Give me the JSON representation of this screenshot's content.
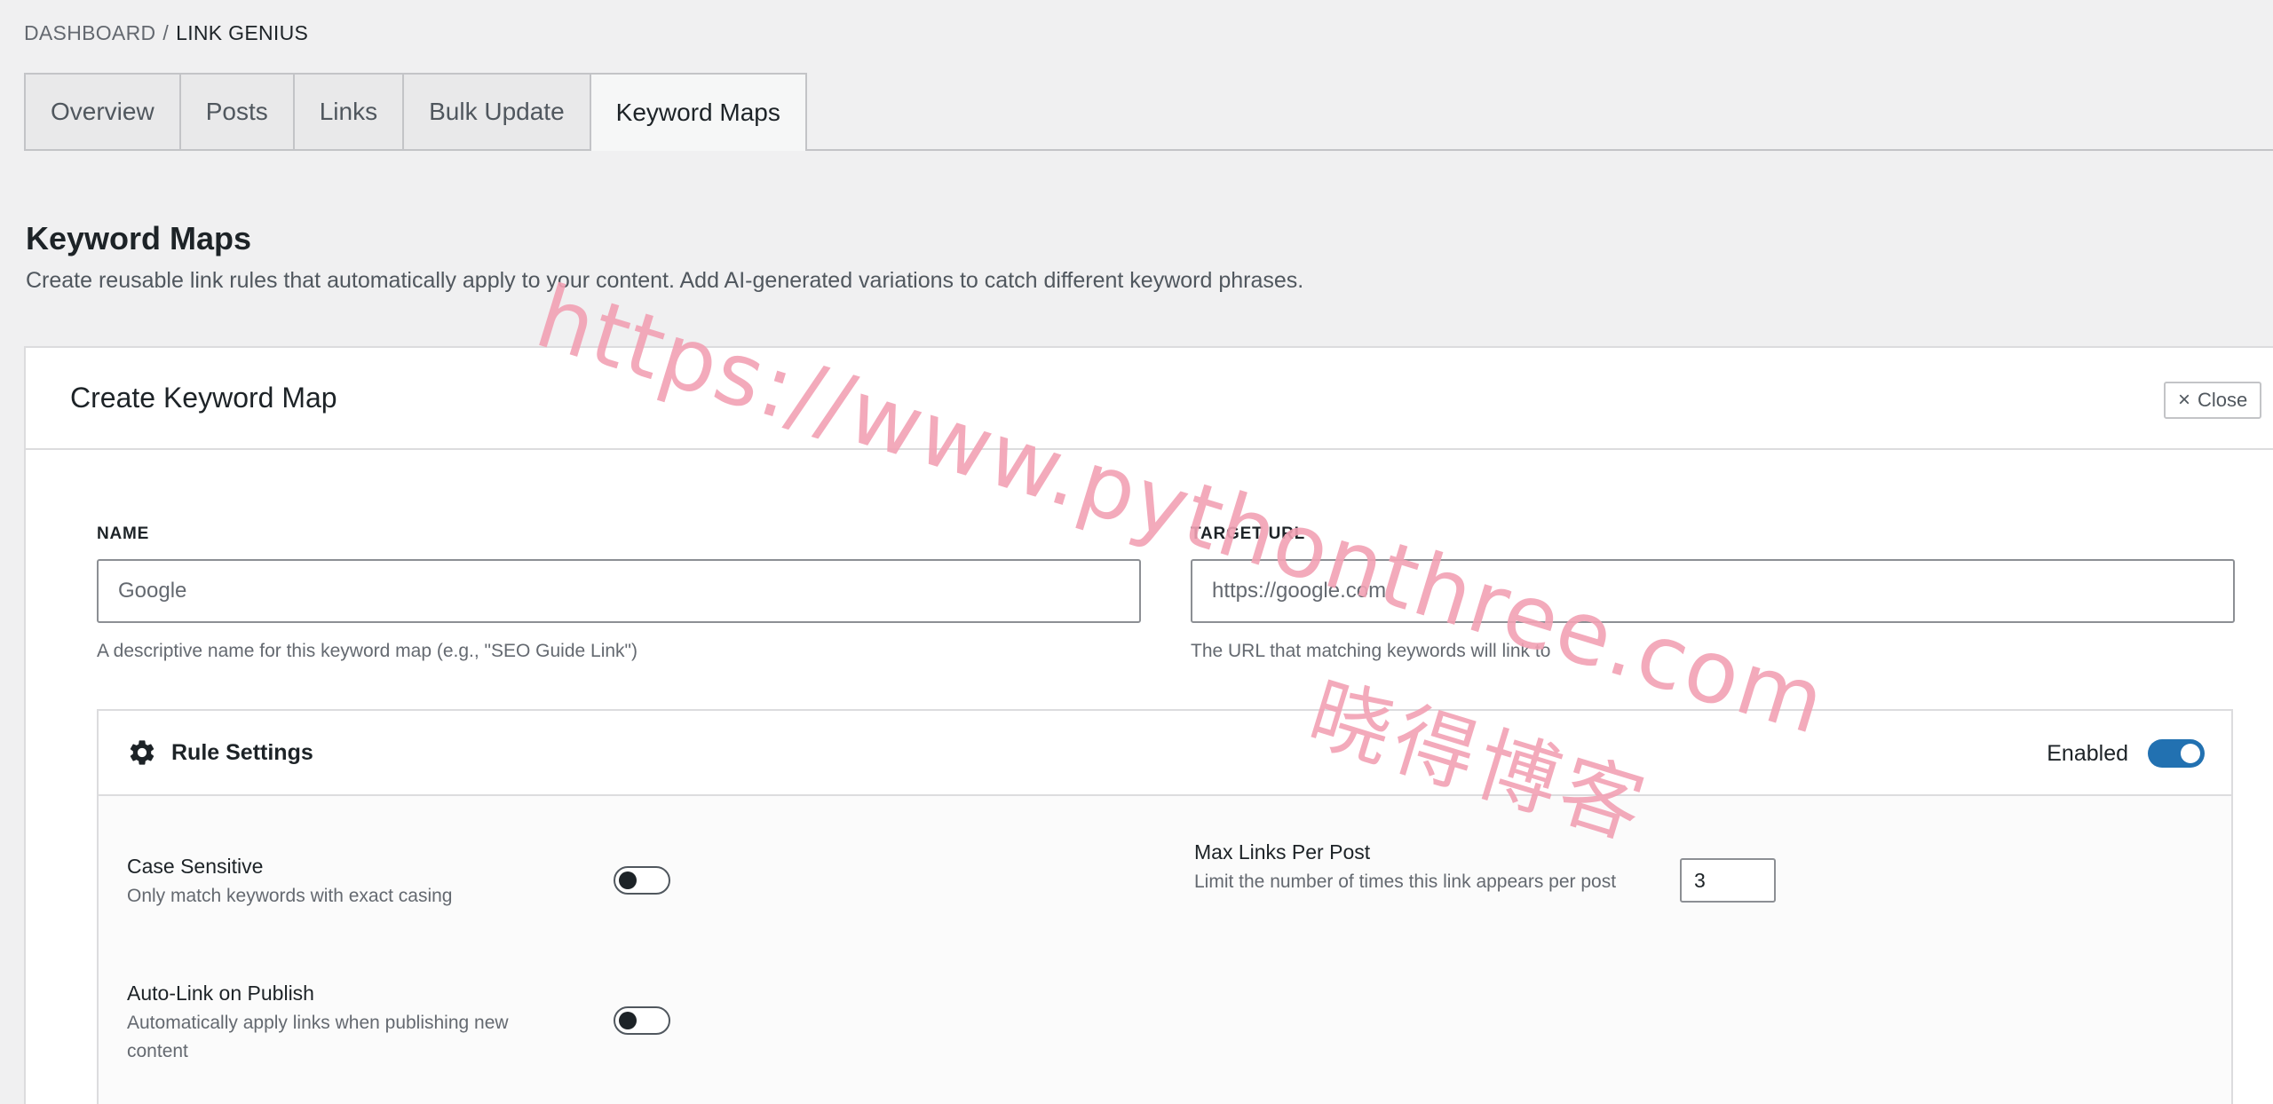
{
  "breadcrumb": {
    "root": "DASHBOARD",
    "separator": "/",
    "current": "LINK GENIUS"
  },
  "tabs": [
    {
      "label": "Overview"
    },
    {
      "label": "Posts"
    },
    {
      "label": "Links"
    },
    {
      "label": "Bulk Update"
    },
    {
      "label": "Keyword Maps",
      "active": true
    }
  ],
  "page": {
    "title": "Keyword Maps",
    "description": "Create reusable link rules that automatically apply to your content. Add AI-generated variations to catch different keyword phrases."
  },
  "card": {
    "title": "Create Keyword Map",
    "close_icon": "×",
    "close_label": "Close",
    "name_label": "NAME",
    "name_placeholder": "Google",
    "name_help": "A descriptive name for this keyword map (e.g., \"SEO Guide Link\")",
    "url_label": "TARGET URL",
    "url_placeholder": "https://google.com",
    "url_help": "The URL that matching keywords will link to"
  },
  "rules": {
    "icon": "gear-icon",
    "title": "Rule Settings",
    "enabled_label": "Enabled",
    "enabled": true,
    "case_sensitive": {
      "title": "Case Sensitive",
      "desc": "Only match keywords with exact casing",
      "on": false
    },
    "auto_link": {
      "title": "Auto-Link on Publish",
      "desc": "Automatically apply links when publishing new content",
      "on": false
    },
    "max_links": {
      "title": "Max Links Per Post",
      "desc": "Limit the number of times this link appears per post",
      "value": "3"
    }
  },
  "watermark": {
    "url": "https://www.pythonthree.com",
    "cn": "晓得博客"
  },
  "colors": {
    "accent": "#2271b1",
    "watermark": "#f2a1b4",
    "background": "#f0f0f1"
  }
}
